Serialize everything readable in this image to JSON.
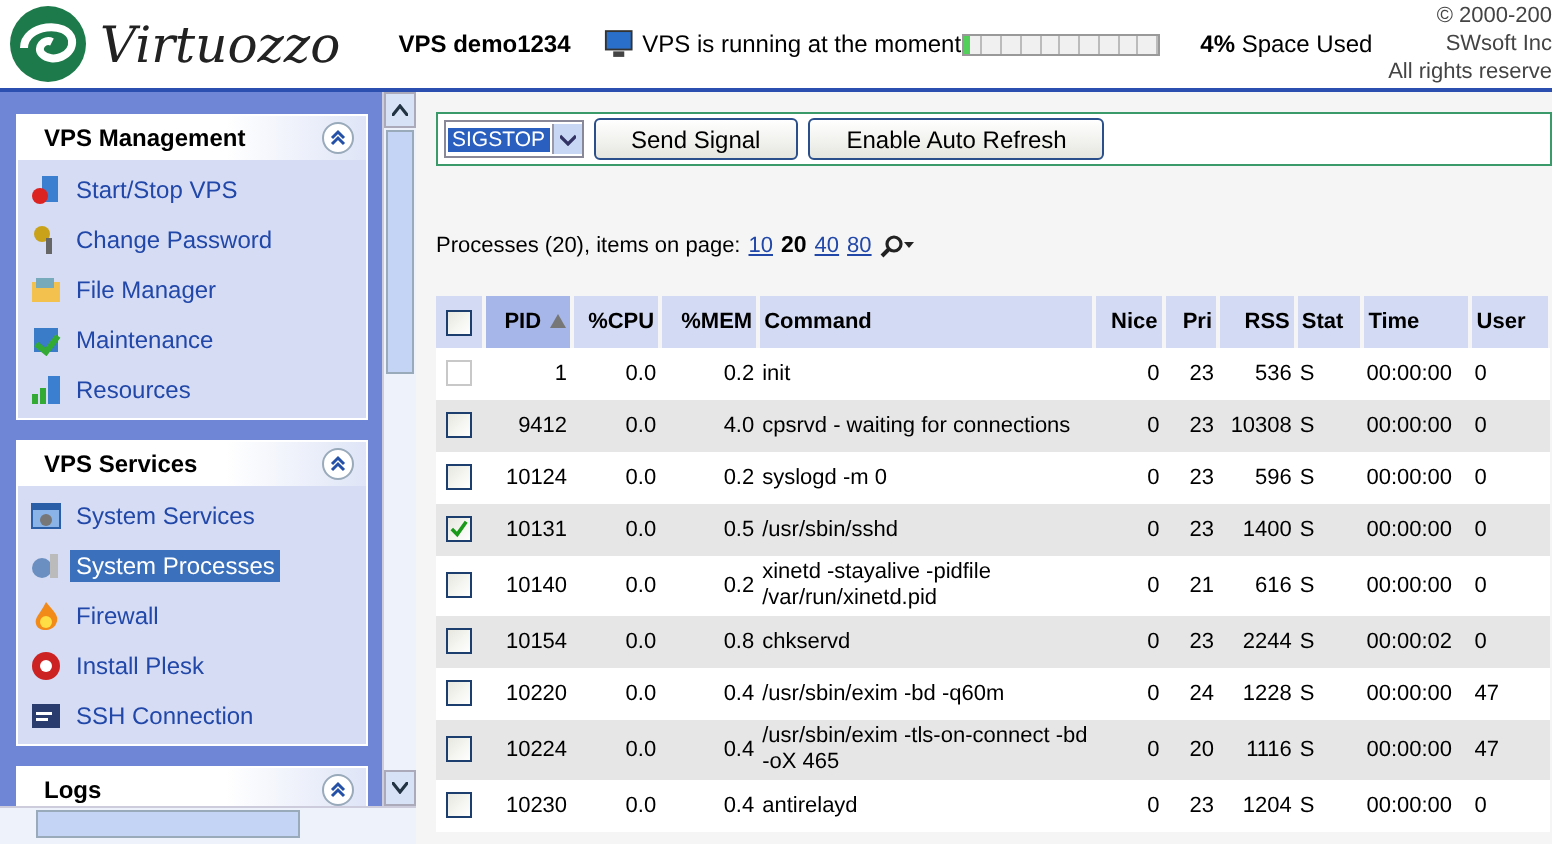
{
  "header": {
    "logo": "Virtuozzo",
    "vps_name": "VPS demo1234",
    "status": "VPS is running at the moment",
    "space": {
      "level": 0.04,
      "percent": "4%",
      "label": "Space Used"
    },
    "copyright": [
      "© 2000-200",
      "SWsoft Inc",
      "All rights reserve"
    ]
  },
  "sidebar": {
    "sections": [
      {
        "title": "VPS Management",
        "expanded": true,
        "items": [
          {
            "label": "Start/Stop VPS",
            "selected": false
          },
          {
            "label": "Change Password",
            "selected": false
          },
          {
            "label": "File Manager",
            "selected": false
          },
          {
            "label": "Maintenance",
            "selected": false
          },
          {
            "label": "Resources",
            "selected": false
          }
        ]
      },
      {
        "title": "VPS Services",
        "expanded": true,
        "items": [
          {
            "label": "System Services",
            "selected": false
          },
          {
            "label": "System Processes",
            "selected": true
          },
          {
            "label": "Firewall",
            "selected": false
          },
          {
            "label": "Install Plesk",
            "selected": false
          },
          {
            "label": "SSH Connection",
            "selected": false
          }
        ]
      },
      {
        "title": "Logs",
        "expanded": true
      }
    ]
  },
  "toolbar": {
    "signal": "SIGSTOP",
    "buttons": [
      "Send Signal",
      "Enable Auto Refresh"
    ]
  },
  "pager": {
    "label": "Processes (20), items on page:",
    "sizes": [
      {
        "label": "10",
        "selected": false
      },
      {
        "label": "20",
        "selected": true
      },
      {
        "label": "40",
        "selected": false
      },
      {
        "label": "80",
        "selected": false
      }
    ]
  },
  "table": {
    "all_checked": false,
    "columns": [
      {
        "label": "PID",
        "sorted": true
      },
      {
        "label": "%CPU",
        "sorted": false
      },
      {
        "label": "%MEM",
        "sorted": false
      },
      {
        "label": "Command",
        "sorted": false
      },
      {
        "label": "Nice",
        "sorted": false
      },
      {
        "label": "Pri",
        "sorted": false
      },
      {
        "label": "RSS",
        "sorted": false
      },
      {
        "label": "Stat",
        "sorted": false
      },
      {
        "label": "Time",
        "sorted": false
      },
      {
        "label": "User",
        "sorted": false
      }
    ],
    "rows": [
      {
        "cells": [
          "1",
          "0.0",
          "0.2",
          "init",
          "0",
          "23",
          "536",
          "S",
          "00:00:00",
          "0"
        ],
        "checked": false,
        "disabled": true
      },
      {
        "cells": [
          "9412",
          "0.0",
          "4.0",
          "cpsrvd - waiting for connections",
          "0",
          "23",
          "10308",
          "S",
          "00:00:00",
          "0"
        ],
        "checked": false,
        "disabled": false
      },
      {
        "cells": [
          "10124",
          "0.0",
          "0.2",
          "syslogd -m 0",
          "0",
          "23",
          "596",
          "S",
          "00:00:00",
          "0"
        ],
        "checked": false,
        "disabled": false
      },
      {
        "cells": [
          "10131",
          "0.0",
          "0.5",
          "/usr/sbin/sshd",
          "0",
          "23",
          "1400",
          "S",
          "00:00:00",
          "0"
        ],
        "checked": true,
        "disabled": false
      },
      {
        "cells": [
          "10140",
          "0.0",
          "0.2",
          "xinetd -stayalive -pidfile /var/run/xinetd.pid",
          "0",
          "21",
          "616",
          "S",
          "00:00:00",
          "0"
        ],
        "checked": false,
        "disabled": false
      },
      {
        "cells": [
          "10154",
          "0.0",
          "0.8",
          "chkservd",
          "0",
          "23",
          "2244",
          "S",
          "00:00:02",
          "0"
        ],
        "checked": false,
        "disabled": false
      },
      {
        "cells": [
          "10220",
          "0.0",
          "0.4",
          "/usr/sbin/exim -bd -q60m",
          "0",
          "24",
          "1228",
          "S",
          "00:00:00",
          "47"
        ],
        "checked": false,
        "disabled": false
      },
      {
        "cells": [
          "10224",
          "0.0",
          "0.4",
          "/usr/sbin/exim -tls-on-connect -bd -oX 465",
          "0",
          "20",
          "1116",
          "S",
          "00:00:00",
          "47"
        ],
        "checked": false,
        "disabled": false
      },
      {
        "cells": [
          "10230",
          "0.0",
          "0.4",
          "antirelayd",
          "0",
          "23",
          "1204",
          "S",
          "00:00:00",
          "0"
        ],
        "checked": false,
        "disabled": false
      }
    ]
  }
}
